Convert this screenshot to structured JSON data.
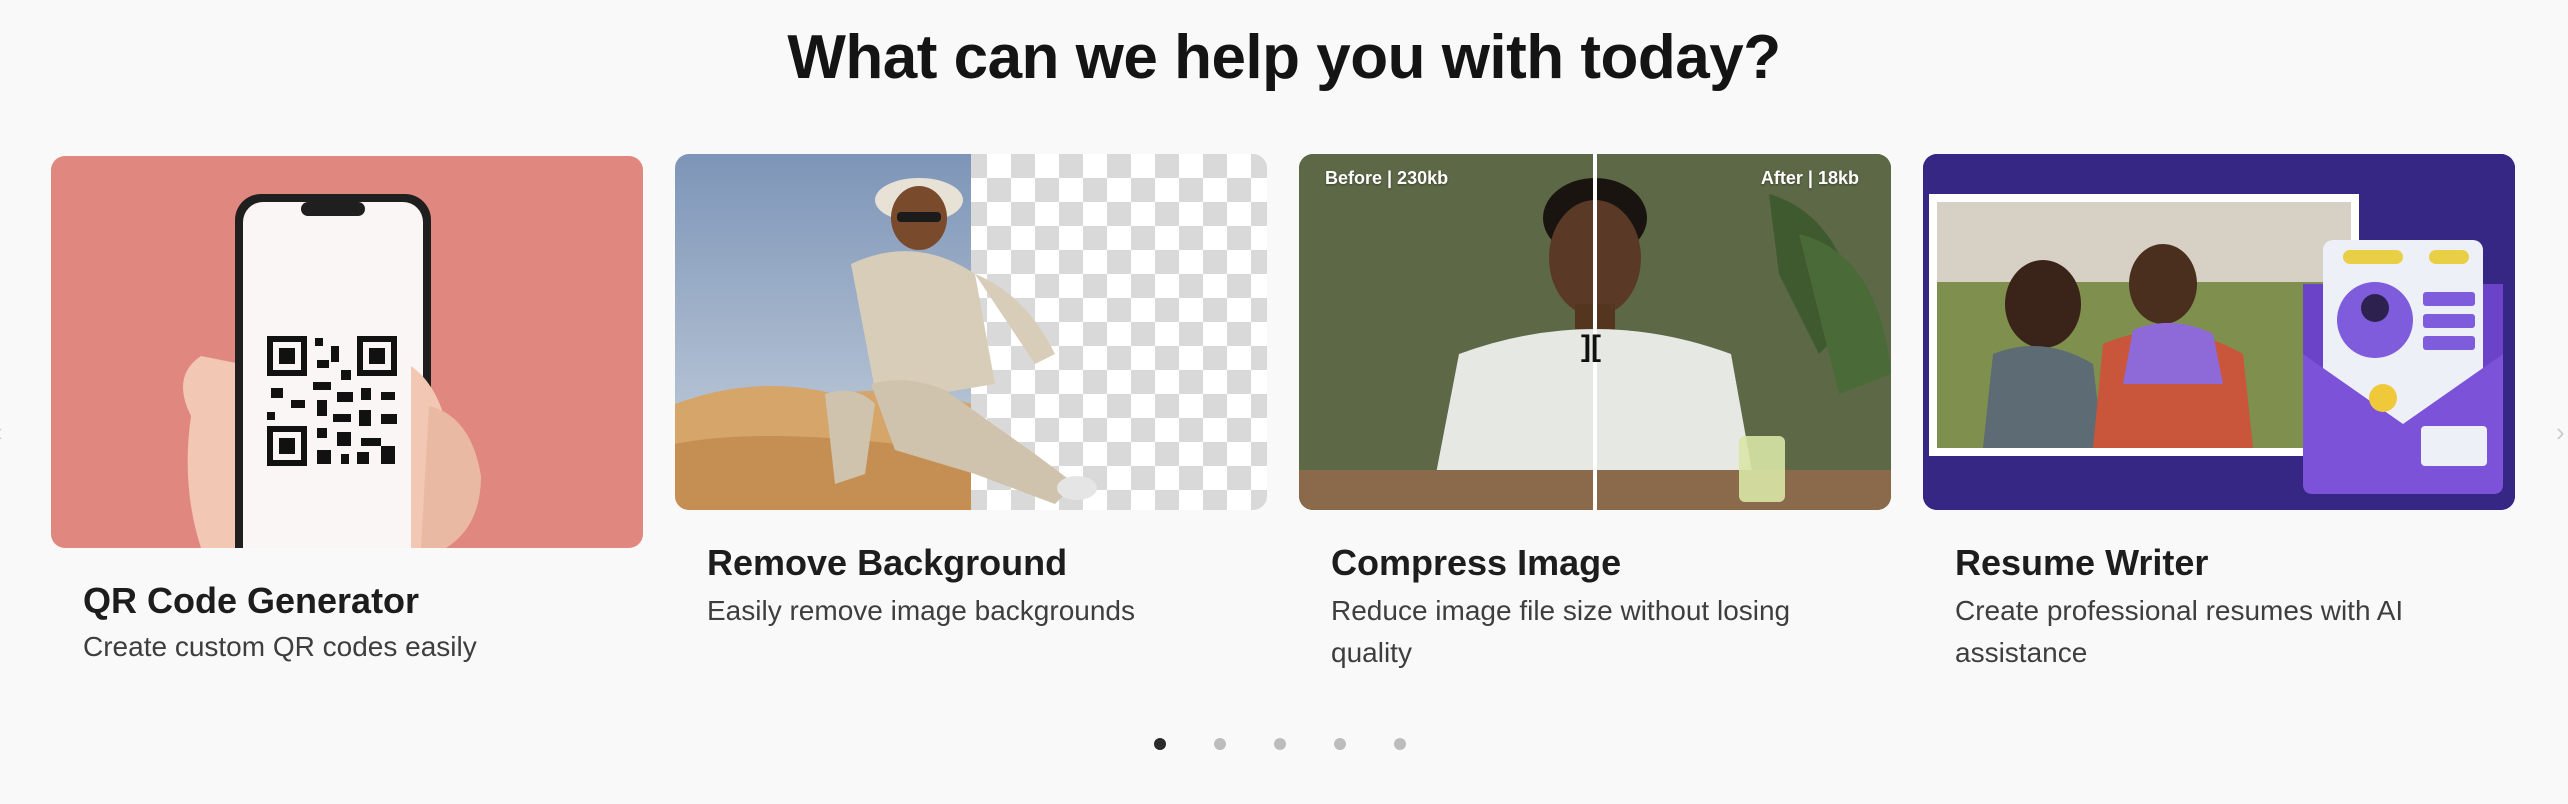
{
  "header": {
    "title": "What can we help you with today?"
  },
  "cards": [
    {
      "title": "QR Code Generator",
      "description": "Create custom QR codes easily"
    },
    {
      "title": "Remove Background",
      "description": "Easily remove image backgrounds"
    },
    {
      "title": "Compress Image",
      "description": "Reduce image file size without losing quality",
      "before_label": "Before | 230kb",
      "after_label": "After | 18kb"
    },
    {
      "title": "Resume Writer",
      "description": "Create professional resumes with AI assistance"
    }
  ],
  "carousel": {
    "page_count": 5,
    "active_index": 0
  },
  "colors": {
    "qr_bg": "#e08880",
    "resume_bg": "#3a2a85",
    "compress_bg": "#5f6a48",
    "accent_purple": "#6b4bd0"
  },
  "icons": {
    "prev": "chevron-left-icon",
    "next": "chevron-right-icon"
  }
}
